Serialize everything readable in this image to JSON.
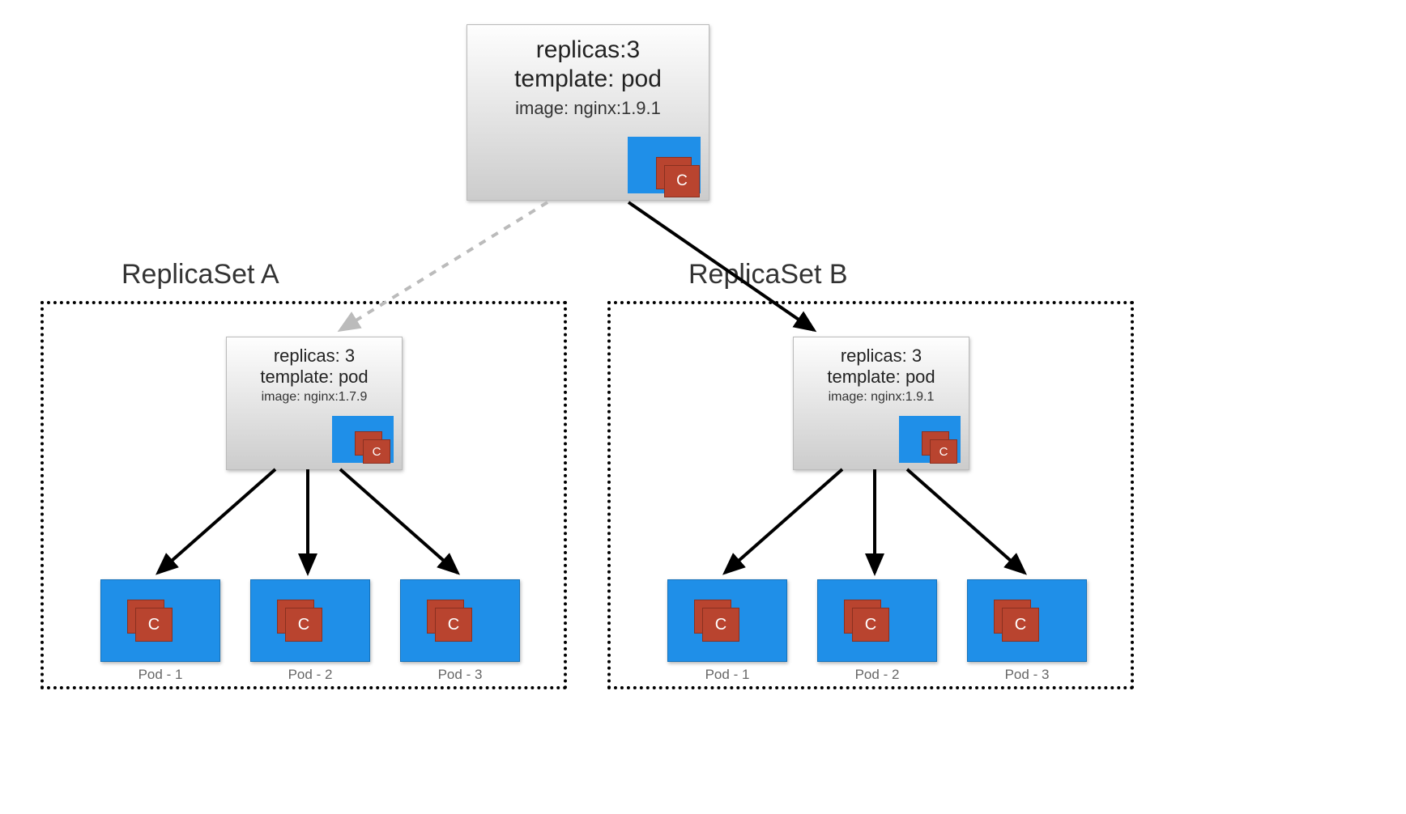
{
  "deployment": {
    "replicas": "replicas:3",
    "template": "template: pod",
    "image": "image: nginx:1.9.1"
  },
  "icon_label": "C",
  "replicaSetA": {
    "title": "ReplicaSet A",
    "replicas": "replicas: 3",
    "template": "template: pod",
    "image": "image: nginx:1.7.9",
    "pods": [
      "Pod - 1",
      "Pod - 2",
      "Pod - 3"
    ]
  },
  "replicaSetB": {
    "title": "ReplicaSet B",
    "replicas": "replicas: 3",
    "template": "template: pod",
    "image": "image: nginx:1.9.1",
    "pods": [
      "Pod - 1",
      "Pod - 2",
      "Pod - 3"
    ]
  }
}
